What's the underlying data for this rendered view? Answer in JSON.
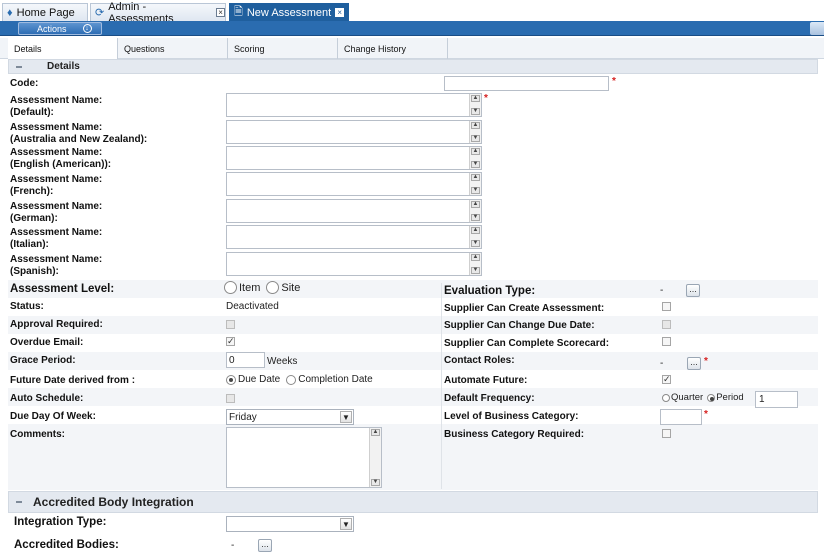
{
  "tabs": [
    {
      "label": "Home Page",
      "icon": "home-icon",
      "close": false
    },
    {
      "label": "Admin - Assessments",
      "icon": "refresh-icon",
      "close": true
    },
    {
      "label": "New Assessment",
      "icon": "document-icon",
      "close": true
    }
  ],
  "actions_label": "Actions",
  "subtabs": [
    "Details",
    "Questions",
    "Scoring",
    "Change History"
  ],
  "section_details": "Details",
  "labels": {
    "code": "Code:",
    "name_default": [
      "Assessment Name:",
      "(Default):"
    ],
    "name_au": [
      "Assessment Name:",
      "(Australia and New Zealand):"
    ],
    "name_us": [
      "Assessment Name:",
      "(English (American)):"
    ],
    "name_fr": [
      "Assessment Name:",
      "(French):"
    ],
    "name_de": [
      "Assessment Name:",
      "(German):"
    ],
    "name_it": [
      "Assessment Name:",
      "(Italian):"
    ],
    "name_es": [
      "Assessment Name:",
      "(Spanish):"
    ],
    "assessment_level": "Assessment Level:",
    "status": "Status:",
    "approval_required": "Approval Required:",
    "overdue_email": "Overdue Email:",
    "grace_period": "Grace Period:",
    "future_date": "Future Date derived from :",
    "auto_schedule": "Auto Schedule:",
    "due_day": "Due Day Of Week:",
    "comments": "Comments:",
    "evaluation_type": "Evaluation Type:",
    "supplier_create": "Supplier Can Create Assessment:",
    "supplier_change": "Supplier Can Change Due Date:",
    "supplier_complete": "Supplier Can Complete Scorecard:",
    "contact_roles": "Contact Roles:",
    "automate_future": "Automate Future:",
    "default_frequency": "Default Frequency:",
    "level_business": "Level of Business Category:",
    "business_required": "Business Category Required:"
  },
  "values": {
    "level_item": "Item",
    "level_site": "Site",
    "status": "Deactivated",
    "grace_period": "0",
    "grace_unit": "Weeks",
    "due_date_opt": "Due Date",
    "completion_date_opt": "Completion Date",
    "due_day": "Friday",
    "evaluation_dash": "-",
    "contact_dash": "-",
    "freq_quarter": "Quarter",
    "freq_period": "Period",
    "freq_value": "1",
    "dots": "...",
    "required_mark": "*"
  },
  "section_accredited": "Accredited Body Integration",
  "accredited": {
    "integration_type": "Integration Type:",
    "accredited_bodies": "Accredited Bodies:",
    "bodies_dash": "-"
  }
}
